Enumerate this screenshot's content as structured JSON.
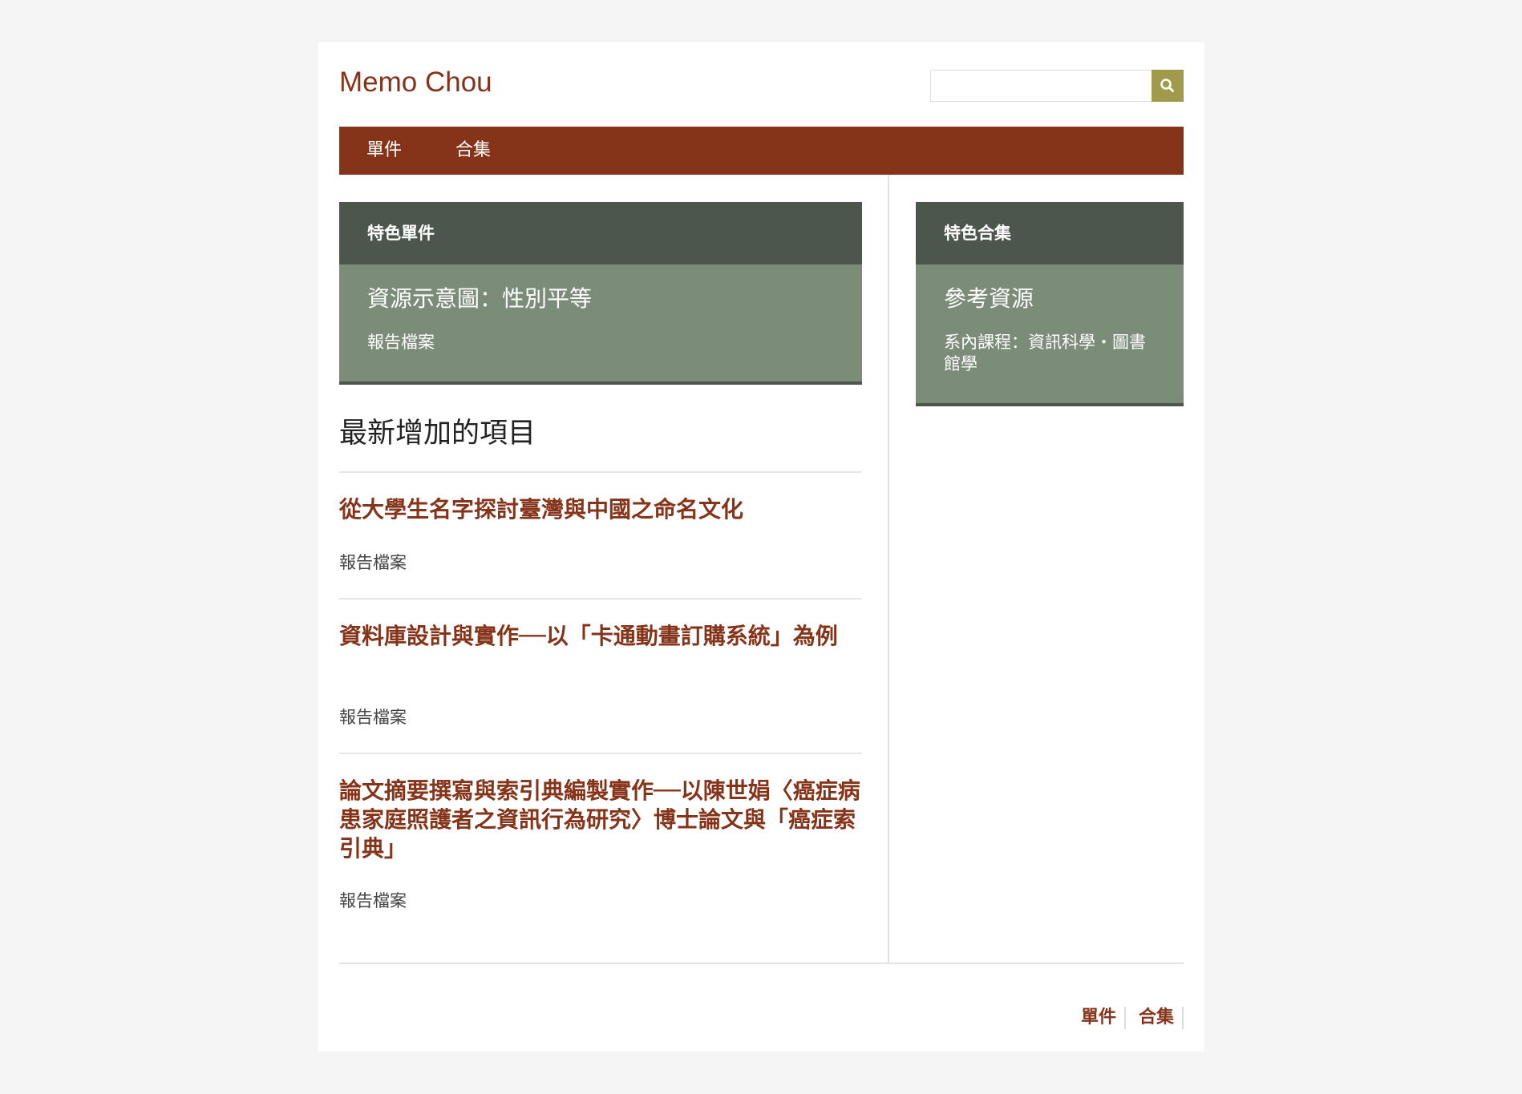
{
  "site": {
    "title": "Memo Chou"
  },
  "search": {
    "value": "",
    "placeholder": ""
  },
  "nav": {
    "items": [
      {
        "label": "單件"
      },
      {
        "label": "合集"
      }
    ]
  },
  "featured_item": {
    "heading": "特色單件",
    "title": "資源示意圖：性別平等",
    "type": "報告檔案"
  },
  "featured_collection": {
    "heading": "特色合集",
    "title": "參考資源",
    "description": "系內課程：資訊科學・圖書館學"
  },
  "recent": {
    "heading": "最新增加的項目",
    "items": [
      {
        "title": "從大學生名字探討臺灣與中國之命名文化",
        "type": "報告檔案"
      },
      {
        "title": "資料庫設計與實作──以「卡通動畫訂購系統」為例",
        "type": "報告檔案"
      },
      {
        "title": "論文摘要撰寫與索引典編製實作──以陳世娟〈癌症病患家庭照護者之資訊行為研究〉博士論文與「癌症索引典」",
        "type": "報告檔案"
      }
    ]
  },
  "footer": {
    "nav": [
      {
        "label": "單件"
      },
      {
        "label": "合集"
      }
    ]
  },
  "colors": {
    "brand": "#85341a",
    "feature_header": "#4c564c",
    "feature_body": "#7b8c79",
    "search_button": "#a09a4a"
  }
}
